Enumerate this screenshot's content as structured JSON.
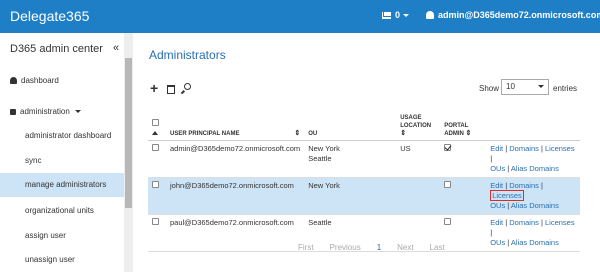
{
  "topbar": {
    "brand": "Delegate365",
    "mail_count": "0",
    "user": "admin@D365demo72.onmicrosoft.com"
  },
  "sidebar": {
    "title": "D365 admin center",
    "collapse": "«",
    "sections": [
      {
        "label": "dashboard",
        "icon": "dashboard-icon"
      },
      {
        "label": "administration",
        "icon": "lock-icon"
      }
    ],
    "items": [
      {
        "label": "administrator dashboard",
        "active": false
      },
      {
        "label": "sync",
        "active": false
      },
      {
        "label": "manage administrators",
        "active": true
      },
      {
        "label": "organizational units",
        "active": false
      },
      {
        "label": "assign user",
        "active": false
      },
      {
        "label": "unassign user",
        "active": false
      }
    ]
  },
  "main": {
    "title": "Administrators",
    "show_label": "Show",
    "show_value": "10",
    "entries_label": "entries",
    "columns": {
      "upn": "USER PRINCIPAL NAME",
      "ou": "OU",
      "usage": "USAGE LOCATION",
      "portal": "PORTAL ADMIN"
    },
    "rows": [
      {
        "upn": "admin@D365demo72.onmicrosoft.com",
        "ou": "New York",
        "ou2": "Seattle",
        "usage": "US",
        "portal": true,
        "selected": false,
        "edit": "Edit",
        "domains": "Domains",
        "licenses": "Licenses",
        "ous": "OUs",
        "alias": "Alias Domains"
      },
      {
        "upn": "john@D365demo72.onmicrosoft.com",
        "ou": "New York",
        "ou2": "",
        "usage": "",
        "portal": false,
        "selected": true,
        "edit": "Edit",
        "domains": "Domains",
        "licenses": "Licenses",
        "ous": "OUs",
        "alias": "Alias Domains"
      },
      {
        "upn": "paul@D365demo72.onmicrosoft.com",
        "ou": "Seattle",
        "ou2": "",
        "usage": "",
        "portal": false,
        "selected": false,
        "edit": "Edit",
        "domains": "Domains",
        "licenses": "Licenses",
        "ous": "OUs",
        "alias": "Alias Domains"
      }
    ],
    "pager": {
      "first": "First",
      "previous": "Previous",
      "current": "1",
      "next": "Next",
      "last": "Last"
    }
  },
  "colors": {
    "brand": "#1f7fc6",
    "selected_row": "#cde4f7",
    "link": "#2a6fb0",
    "highlight": "#d32f2f"
  }
}
